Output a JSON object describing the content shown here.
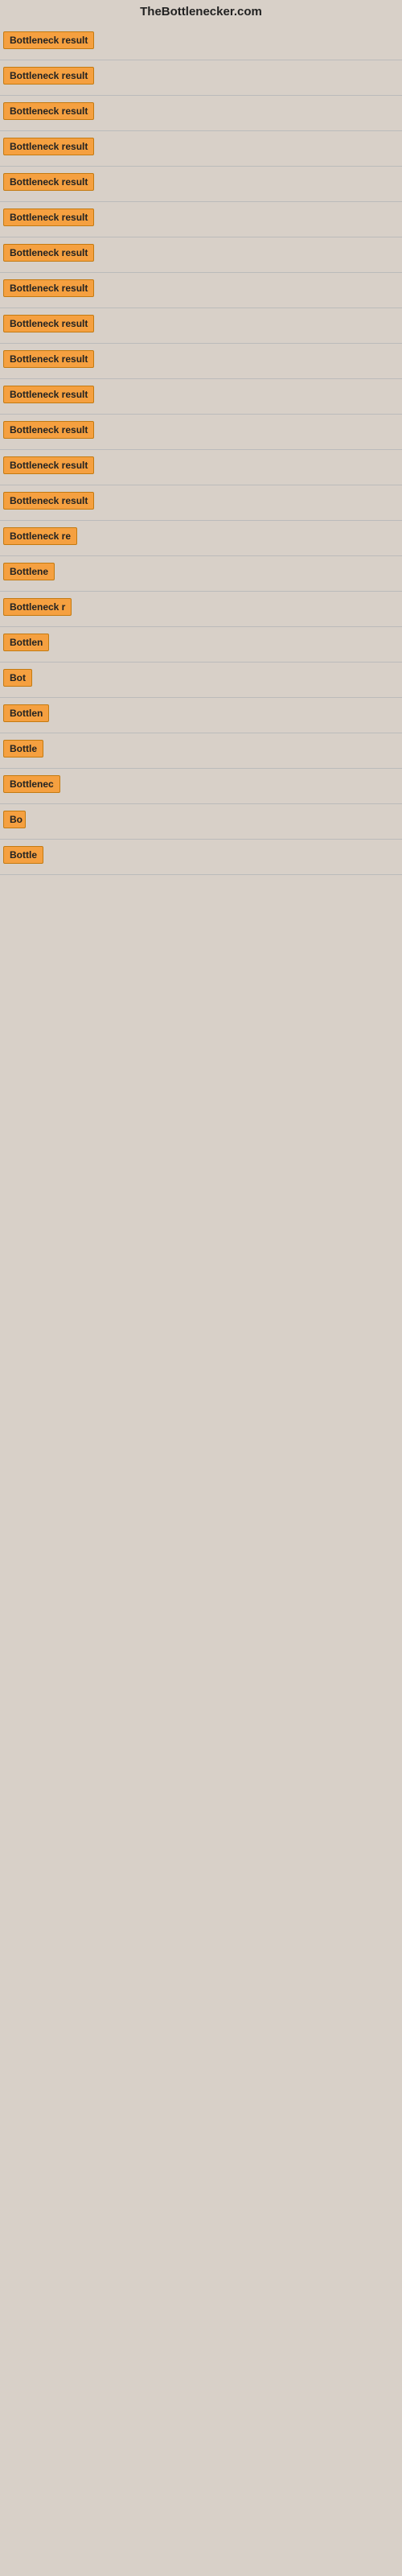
{
  "header": {
    "title": "TheBottlenecker.com"
  },
  "results": [
    {
      "label": "Bottleneck result",
      "width": 115
    },
    {
      "label": "Bottleneck result",
      "width": 115
    },
    {
      "label": "Bottleneck result",
      "width": 115
    },
    {
      "label": "Bottleneck result",
      "width": 115
    },
    {
      "label": "Bottleneck result",
      "width": 115
    },
    {
      "label": "Bottleneck result",
      "width": 115
    },
    {
      "label": "Bottleneck result",
      "width": 115
    },
    {
      "label": "Bottleneck result",
      "width": 115
    },
    {
      "label": "Bottleneck result",
      "width": 115
    },
    {
      "label": "Bottleneck result",
      "width": 115
    },
    {
      "label": "Bottleneck result",
      "width": 115
    },
    {
      "label": "Bottleneck result",
      "width": 115
    },
    {
      "label": "Bottleneck result",
      "width": 115
    },
    {
      "label": "Bottleneck result",
      "width": 115
    },
    {
      "label": "Bottleneck re",
      "width": 95
    },
    {
      "label": "Bottlene",
      "width": 72
    },
    {
      "label": "Bottleneck r",
      "width": 85
    },
    {
      "label": "Bottlen",
      "width": 65
    },
    {
      "label": "Bot",
      "width": 38
    },
    {
      "label": "Bottlen",
      "width": 62
    },
    {
      "label": "Bottle",
      "width": 55
    },
    {
      "label": "Bottlenec",
      "width": 78
    },
    {
      "label": "Bo",
      "width": 28
    },
    {
      "label": "Bottle",
      "width": 52
    }
  ],
  "colors": {
    "badge_bg": "#f5a040",
    "badge_border": "#c47a10",
    "bg": "#d8d0c8",
    "header_text": "#222222"
  }
}
